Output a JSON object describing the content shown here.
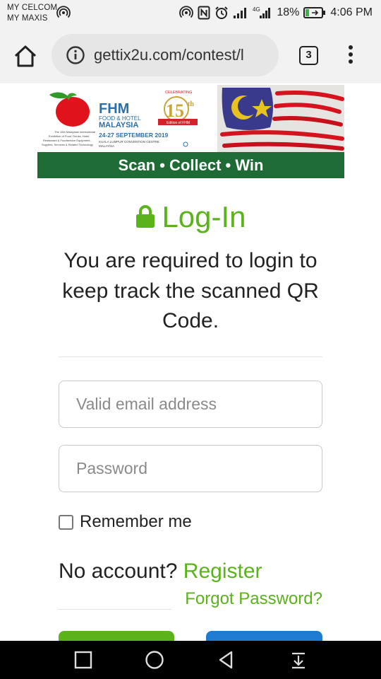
{
  "status_bar": {
    "carrier_1": "MY CELCOM",
    "carrier_2": "MY MAXIS",
    "battery": "18%",
    "time": "4:06 PM"
  },
  "browser": {
    "url": "gettix2u.com/contest/l",
    "tab_count": "3"
  },
  "banner": {
    "brand": "FHM",
    "name_line1": "FOOD & HOTEL",
    "name_line2": "MALAYSIA",
    "dates": "24-27 SEPTEMBER 2019",
    "venue_1": "KUALA LUMPUR CONVENTION CENTRE",
    "venue_2": "MALAYSIA",
    "celebrating": "CELEBRATING",
    "anniversary": "15",
    "anniversary_suffix": "th",
    "edition": "Edition of FHM",
    "tagline": "Scan • Collect • Win"
  },
  "login": {
    "title": "Log-In",
    "subtitle": "You are required to login to keep track the scanned QR Code.",
    "email_placeholder": "Valid email address",
    "password_placeholder": "Password",
    "remember_label": "Remember me",
    "no_account": "No account?",
    "register": "Register",
    "forgot": "Forgot Password?"
  },
  "colors": {
    "accent_green": "#5bb31c",
    "banner_green": "#1e6b35",
    "button_blue": "#1f7ad1"
  }
}
